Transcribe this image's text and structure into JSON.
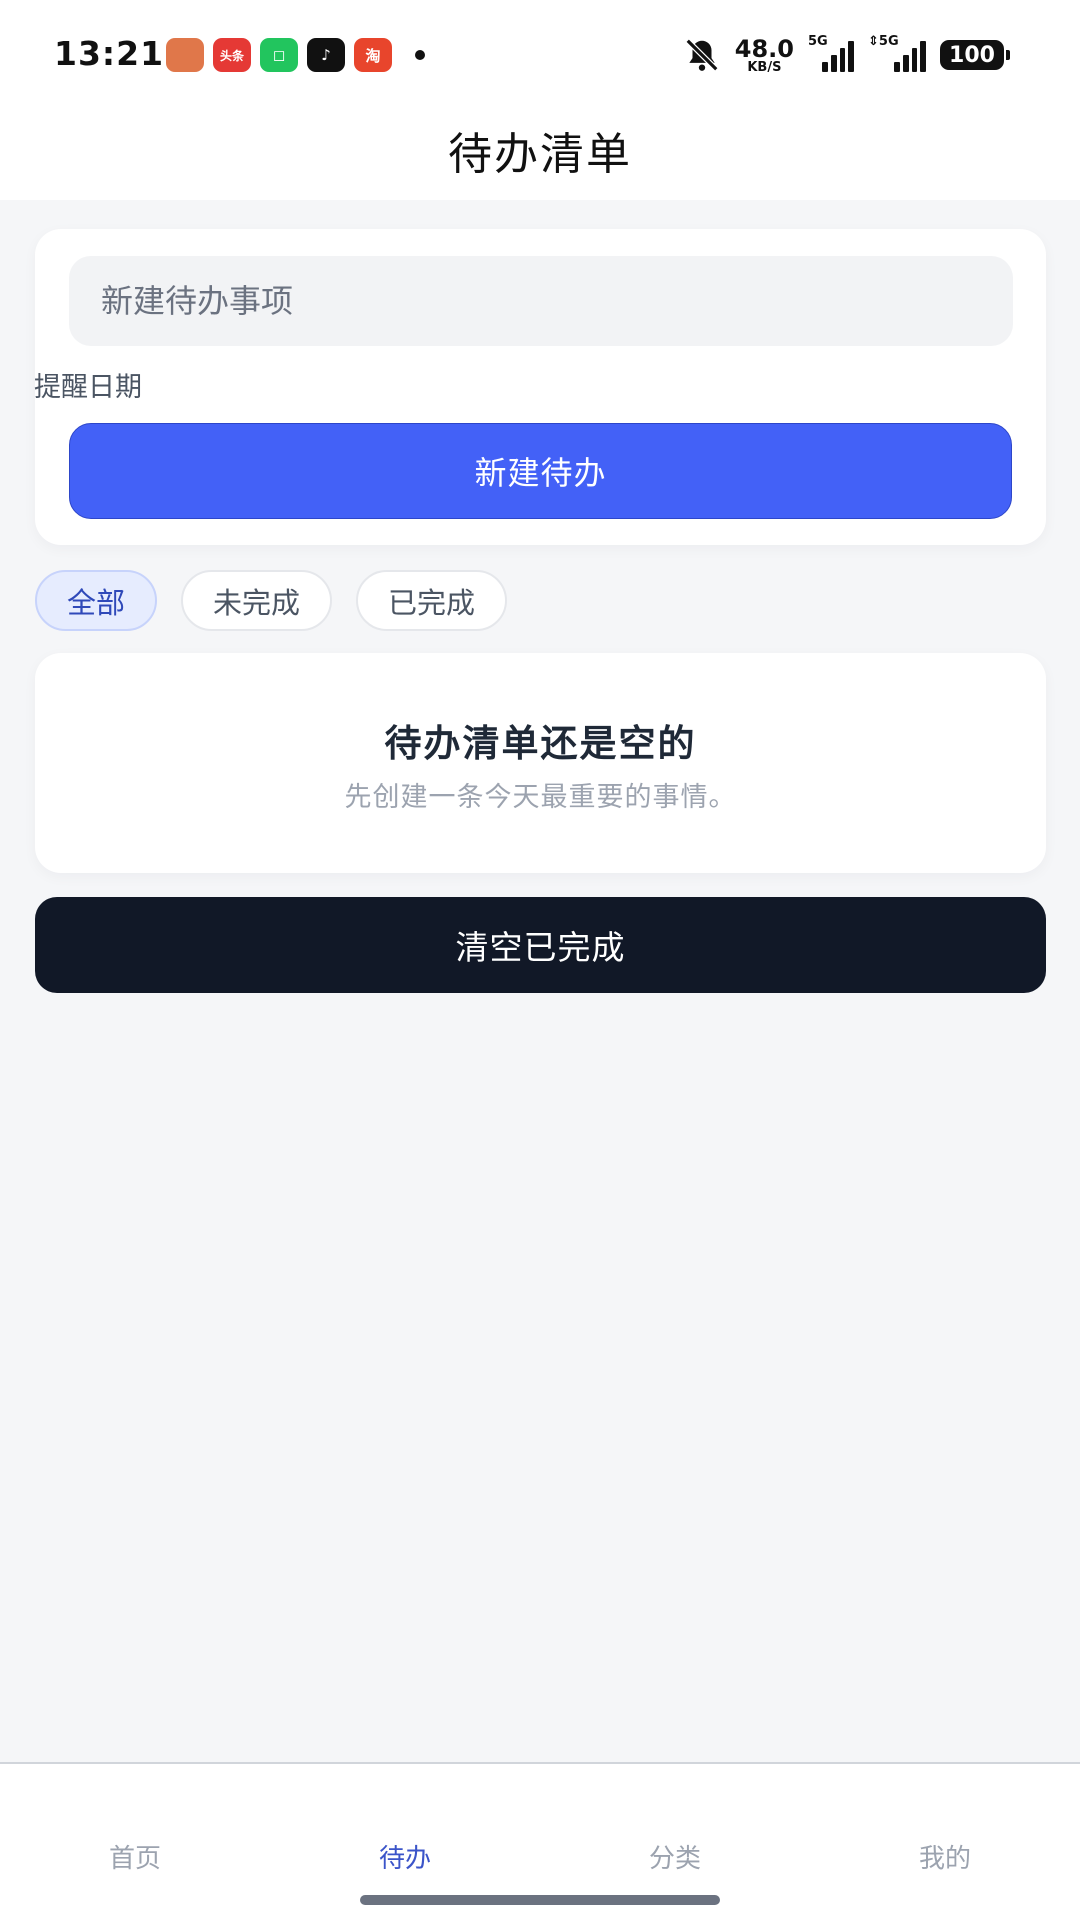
{
  "status_bar": {
    "time": "13:21",
    "apps": [
      {
        "name": "game-app-icon",
        "label": "",
        "color": "#e0774a"
      },
      {
        "name": "toutiao-app-icon",
        "label": "头条",
        "color": "#e53935"
      },
      {
        "name": "green-app-icon",
        "label": "◻",
        "color": "#22c55e"
      },
      {
        "name": "tiktok-app-icon",
        "label": "♪",
        "color": "#111111"
      },
      {
        "name": "taobao-app-icon",
        "label": "淘",
        "color": "#e8452c"
      }
    ],
    "net_speed_value": "48.0",
    "net_speed_unit": "KB/S",
    "signal1_label": "5G",
    "signal2_label": "⇕5G",
    "battery": "100"
  },
  "header": {
    "title": "待办清单"
  },
  "create": {
    "input_placeholder": "新建待办事项",
    "input_value": "",
    "date_label": "提醒日期",
    "button_label": "新建待办"
  },
  "filters": [
    {
      "label": "全部",
      "active": true
    },
    {
      "label": "未完成",
      "active": false
    },
    {
      "label": "已完成",
      "active": false
    }
  ],
  "empty_state": {
    "title": "待办清单还是空的",
    "subtitle": "先创建一条今天最重要的事情。"
  },
  "clear_button_label": "清空已完成",
  "bottom_nav": [
    {
      "label": "首页",
      "active": false
    },
    {
      "label": "待办",
      "active": true
    },
    {
      "label": "分类",
      "active": false
    },
    {
      "label": "我的",
      "active": false
    }
  ],
  "colors": {
    "accent": "#4361f7",
    "dark": "#111827",
    "background": "#f5f6f8",
    "nav_active": "#3b54c9"
  }
}
